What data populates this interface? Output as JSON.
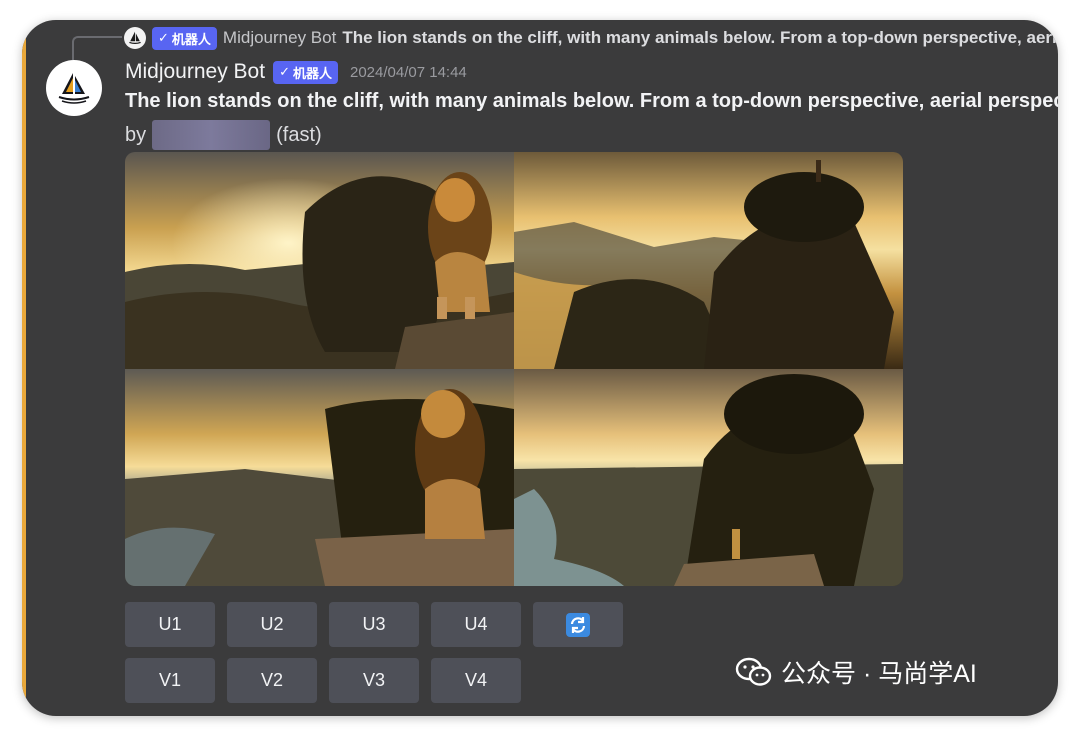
{
  "reply": {
    "badge_label": "机器人",
    "author": "Midjourney Bot",
    "text": "The lion stands on the cliff, with many animals below. From a top-down perspective, aerial perspective"
  },
  "message": {
    "author": "Midjourney Bot",
    "badge_label": "机器人",
    "timestamp": "2024/04/07 14:44",
    "prompt": "The lion stands on the cliff, with many animals below. From a top-down perspective, aerial perspective",
    "by_prefix": "by",
    "speed": "(fast)"
  },
  "images": {
    "tile1": "lion-closeup-on-rock",
    "tile2": "tree-on-cliff-with-figure",
    "tile3": "lion-sitting-on-cliff",
    "tile4": "person-on-cliff-below-tree"
  },
  "buttons": {
    "u1": "U1",
    "u2": "U2",
    "u3": "U3",
    "u4": "U4",
    "reroll_icon": "refresh-icon",
    "v1": "V1",
    "v2": "V2",
    "v3": "V3",
    "v4": "V4"
  },
  "watermark": {
    "text": "公众号 · 马尚学AI"
  },
  "colors": {
    "background": "#3b3b3c",
    "accent": "#e9a83a",
    "badge": "#5865f2",
    "button": "#4e5058",
    "reroll_icon": "#3b8ae0"
  }
}
